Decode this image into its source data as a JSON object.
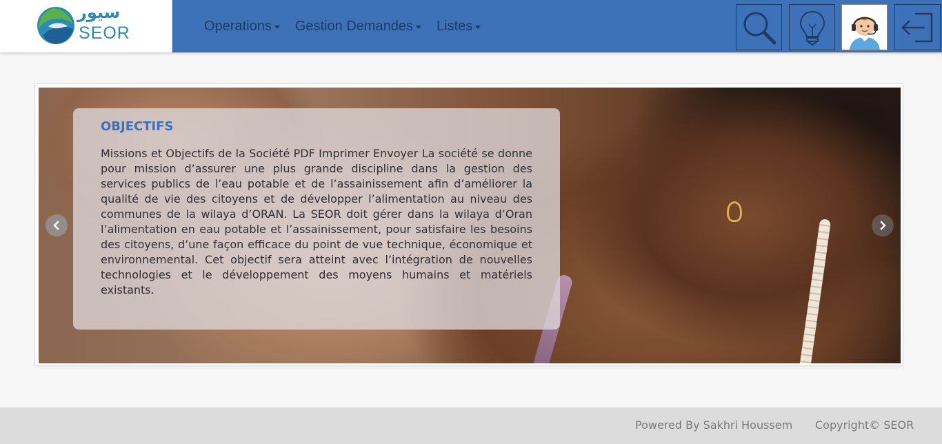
{
  "brand": {
    "arabic_name": "سيور",
    "latin_name": "SEOR",
    "logo_icon": "seor-logo-icon"
  },
  "nav": {
    "items": [
      {
        "label": "Operations"
      },
      {
        "label": "Gestion Demandes"
      },
      {
        "label": "Listes"
      }
    ]
  },
  "header_buttons": {
    "search_icon": "search-icon",
    "idea_icon": "lightbulb-icon",
    "support_icon": "support-agent-avatar",
    "logout_icon": "logout-icon"
  },
  "carousel": {
    "caption_title": "OBJECTIFS",
    "caption_text": "Missions et Objectifs de la Société PDF Imprimer Envoyer La société se donne pour mission d’assurer une plus grande discipline dans la gestion des services publics de l’eau potable et de l’assainissement afin d’améliorer la qualité de vie des citoyens et de développer l’alimentation au niveau des communes de la wilaya d’ORAN. La SEOR doit gérer dans la wilaya d’Oran l’alimentation en eau potable et l’assainissement, pour satisfaire les besoins des citoyens, d’une façon efficace du point de vue technique, économique et environnemental. Cet objectif sera atteint avec l’intégration de nouvelles technologies et le développement des moyens humains et matériels existants.",
    "prev_icon": "chevron-left-icon",
    "next_icon": "chevron-right-icon"
  },
  "footer": {
    "powered_by": "Powered By Sakhri Houssem",
    "copyright": "Copyright© SEOR"
  },
  "colors": {
    "header_bg": "#3e72b8",
    "nav_text": "#1d3b66",
    "caption_title": "#3e72b8",
    "footer_bg": "#dcdcdc"
  }
}
